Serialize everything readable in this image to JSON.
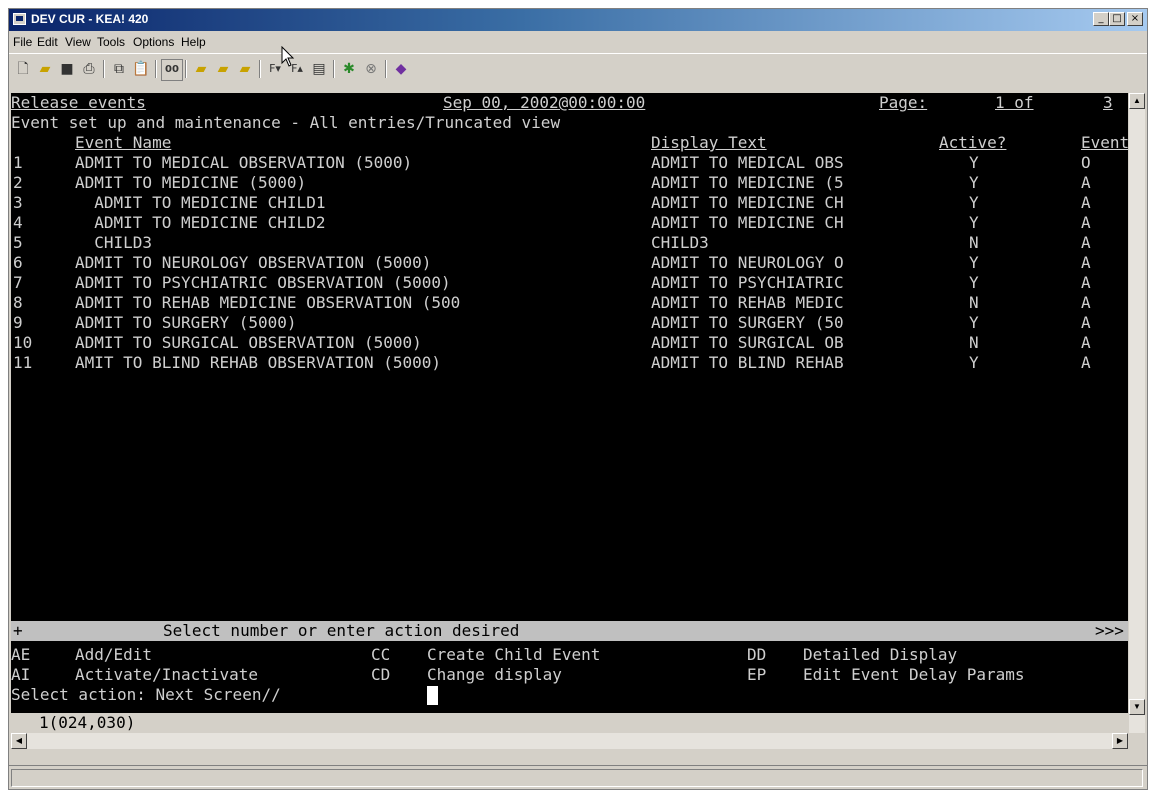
{
  "window": {
    "title": "DEV CUR - KEA! 420"
  },
  "menu": [
    "File",
    "Edit",
    "View",
    "Tools",
    "Options",
    "Help"
  ],
  "toolbar_icons": [
    "new-icon",
    "open-icon",
    "save-icon",
    "print-icon",
    "copy-icon",
    "paste-icon",
    "capture-icon",
    "folder-a-icon",
    "folder-b-icon",
    "folder-c-icon",
    "font-down-icon",
    "font-up-icon",
    "keyboard-icon",
    "traffic-light-icon",
    "stop-icon",
    "book-icon"
  ],
  "terminal": {
    "header": {
      "title": "Release events",
      "date": "Sep 00, 2002@00:00:00",
      "page_label": "Page:",
      "page_value": "1 of",
      "page_total": "3"
    },
    "subtitle": "Event set up and maintenance - All entries/Truncated view",
    "columns": {
      "event_name": "Event Name",
      "display_text": "Display Text",
      "active": "Active?",
      "event": "Event"
    },
    "rows": [
      {
        "num": "1",
        "name": "ADMIT TO MEDICAL OBSERVATION (5000)",
        "display": "ADMIT TO MEDICAL OBS",
        "active": "Y",
        "event": "O"
      },
      {
        "num": "2",
        "name": "ADMIT TO MEDICINE (5000)",
        "display": "ADMIT TO MEDICINE (5",
        "active": "Y",
        "event": "A"
      },
      {
        "num": "3",
        "name": "  ADMIT TO MEDICINE CHILD1",
        "display": "ADMIT TO MEDICINE CH",
        "active": "Y",
        "event": "A"
      },
      {
        "num": "4",
        "name": "  ADMIT TO MEDICINE CHILD2",
        "display": "ADMIT TO MEDICINE CH",
        "active": "Y",
        "event": "A"
      },
      {
        "num": "5",
        "name": "  CHILD3",
        "display": "CHILD3",
        "active": "N",
        "event": "A"
      },
      {
        "num": "6",
        "name": "ADMIT TO NEUROLOGY OBSERVATION (5000)",
        "display": "ADMIT TO NEUROLOGY O",
        "active": "Y",
        "event": "A"
      },
      {
        "num": "7",
        "name": "ADMIT TO PSYCHIATRIC OBSERVATION (5000)",
        "display": "ADMIT TO PSYCHIATRIC",
        "active": "Y",
        "event": "A"
      },
      {
        "num": "8",
        "name": "ADMIT TO REHAB MEDICINE OBSERVATION (500",
        "display": "ADMIT TO REHAB MEDIC",
        "active": "N",
        "event": "A"
      },
      {
        "num": "9",
        "name": "ADMIT TO SURGERY (5000)",
        "display": "ADMIT TO SURGERY (50",
        "active": "Y",
        "event": "A"
      },
      {
        "num": "10",
        "name": "ADMIT TO SURGICAL OBSERVATION (5000)",
        "display": "ADMIT TO SURGICAL OB",
        "active": "N",
        "event": "A"
      },
      {
        "num": "11",
        "name": "AMIT TO BLIND REHAB OBSERVATION (5000)",
        "display": "ADMIT TO BLIND REHAB",
        "active": "Y",
        "event": "A"
      }
    ],
    "prompt_bar": {
      "plus": "+",
      "text": "Select number or enter action desired",
      "more": ">>>"
    },
    "actions": [
      [
        {
          "code": "AE",
          "label": "Add/Edit"
        },
        {
          "code": "CC",
          "label": "Create Child Event"
        },
        {
          "code": "DD",
          "label": "Detailed Display"
        }
      ],
      [
        {
          "code": "AI",
          "label": "Activate/Inactivate"
        },
        {
          "code": "CD",
          "label": "Change display"
        },
        {
          "code": "EP",
          "label": "Edit Event Delay Params"
        }
      ]
    ],
    "select_prompt": "Select action: Next Screen// ",
    "cursor_position": "1(024,030)"
  }
}
